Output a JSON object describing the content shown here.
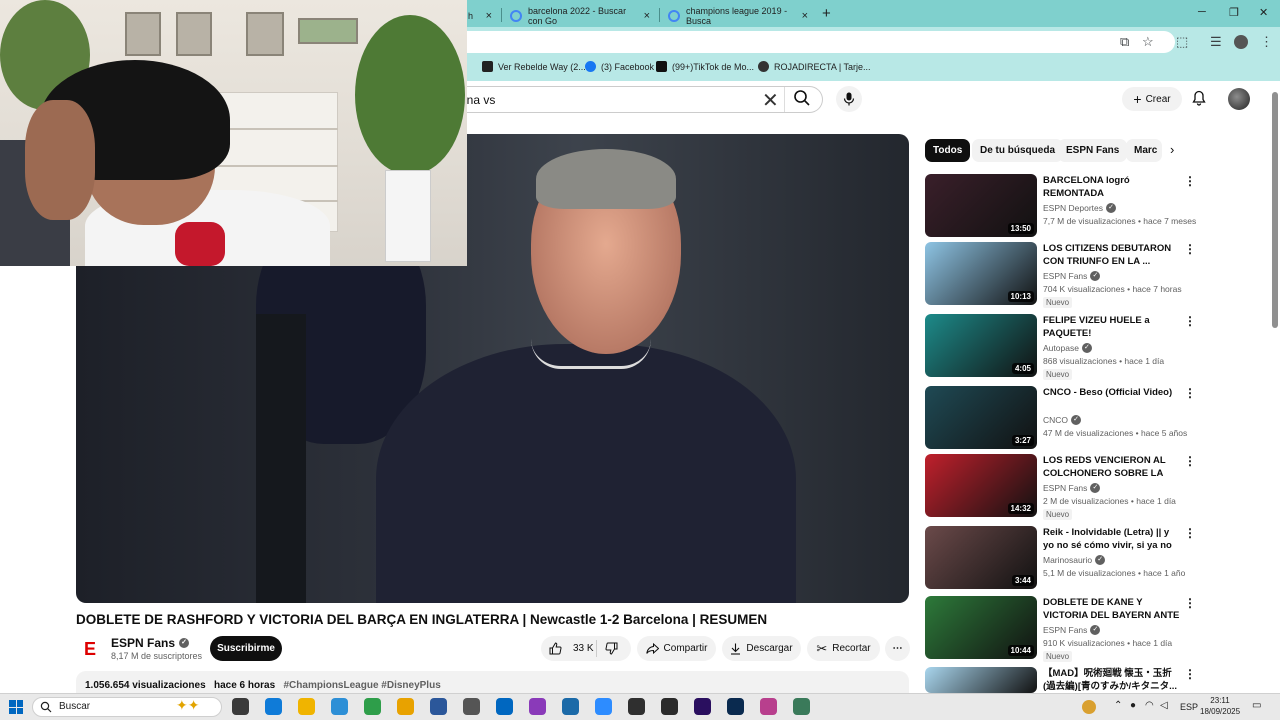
{
  "browser": {
    "tabs": [
      {
        "label": "h",
        "close": "×"
      },
      {
        "label": "barcelona 2022 - Buscar con Go",
        "close": "×"
      },
      {
        "label": "champions league 2019 - Busca",
        "close": "×"
      }
    ],
    "new_tab": "+",
    "bookmarks": [
      {
        "label": "Ver Rebelde Way (2..."
      },
      {
        "label": "(3) Facebook"
      },
      {
        "label": "(99+)TikTok de Mo..."
      },
      {
        "label": "ROJADIRECTA | Tarje..."
      }
    ]
  },
  "youtube": {
    "search_text": "ona vs",
    "create_label": "Crear",
    "video": {
      "title": "DOBLETE DE RASHFORD Y VICTORIA DEL BARÇA EN INGLATERRA | Newcastle 1-2 Barcelona | RESUMEN",
      "channel": "ESPN Fans",
      "subscribers": "8,17 M de suscriptores",
      "subscribe_label": "Suscribirme",
      "likes": "33 K",
      "share_label": "Compartir",
      "download_label": "Descargar",
      "clip_label": "Recortar",
      "views": "1.056.654 visualizaciones",
      "age": "hace 6 horas",
      "tags": "#ChampionsLeague #DisneyPlus"
    },
    "chips": [
      "Todos",
      "De tu búsqueda",
      "ESPN Fans",
      "Marc"
    ],
    "recommendations": [
      {
        "title": "BARCELONA logró REMONTADA ESPECTUCULAR...",
        "channel": "ESPN Deportes",
        "meta": "7,7 M de visualizaciones • hace 7 meses",
        "duration": "13:50",
        "is_new": "",
        "thumb_color": "#3a1f2a"
      },
      {
        "title": "LOS CITIZENS DEBUTARON CON TRIUNFO EN LA ...",
        "channel": "ESPN Fans",
        "meta": "704 K visualizaciones • hace 7 horas",
        "duration": "10:13",
        "is_new": "Nuevo",
        "thumb_color": "#8ec4e4"
      },
      {
        "title": "FELIPE VIZEU HUELE a PAQUETE!",
        "channel": "Autopase",
        "meta": "868 visualizaciones • hace 1 día",
        "duration": "4:05",
        "is_new": "Nuevo",
        "thumb_color": "#1d8b8a"
      },
      {
        "title": "CNCO - Beso (Official Video)",
        "channel": "CNCO",
        "meta": "47 M de visualizaciones • hace 5 años",
        "duration": "3:27",
        "is_new": "",
        "thumb_color": "#1f4a55"
      },
      {
        "title": "LOS REDS VENCIERON AL COLCHONERO SOBRE LA HOR...",
        "channel": "ESPN Fans",
        "meta": "2 M de visualizaciones • hace 1 día",
        "duration": "14:32",
        "is_new": "Nuevo",
        "thumb_color": "#c0202c"
      },
      {
        "title": "Reik - Inolvidable (Letra) || y yo no sé cómo vivir, si ya no pued...",
        "channel": "Marinosaurio",
        "meta": "5,1 M de visualizaciones • hace 1 año",
        "duration": "3:44",
        "is_new": "",
        "thumb_color": "#6b4a4a"
      },
      {
        "title": "DOBLETE DE KANE Y VICTORIA DEL BAYERN ANTE LOS BLUE...",
        "channel": "ESPN Fans",
        "meta": "910 K visualizaciones • hace 1 día",
        "duration": "10:44",
        "is_new": "Nuevo",
        "thumb_color": "#2d7a3a"
      },
      {
        "title": "【MAD】呪術廻戦 懐玉・玉折(過去編)[青のすみか/キタニタ...",
        "channel": "",
        "meta": "",
        "duration": "",
        "is_new": "",
        "thumb_color": "#a9d6ee"
      }
    ]
  },
  "taskbar": {
    "search_label": "Buscar",
    "lang": "ESP",
    "time": "23:11",
    "date": "18/09/2025"
  }
}
